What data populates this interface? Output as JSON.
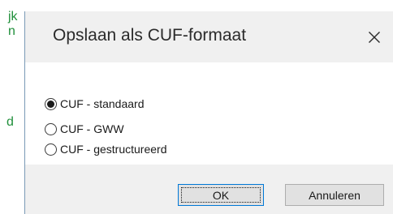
{
  "background_app": {
    "fragments": [
      "jk",
      "n",
      "d"
    ]
  },
  "dialog": {
    "title": "Opslaan als CUF-formaat",
    "close_icon": "close-icon",
    "options": [
      {
        "label": "CUF - standaard",
        "selected": true
      },
      {
        "label": "CUF - GWW",
        "selected": false
      },
      {
        "label": "CUF - gestructureerd",
        "selected": false
      }
    ],
    "buttons": {
      "ok_label": "OK",
      "cancel_label": "Annuleren"
    }
  },
  "colors": {
    "titlebar_bg": "#f0f0f0",
    "footer_bg": "#f0f0f0",
    "focus_border": "#0078d7",
    "background_text": "#1f8f3a"
  }
}
